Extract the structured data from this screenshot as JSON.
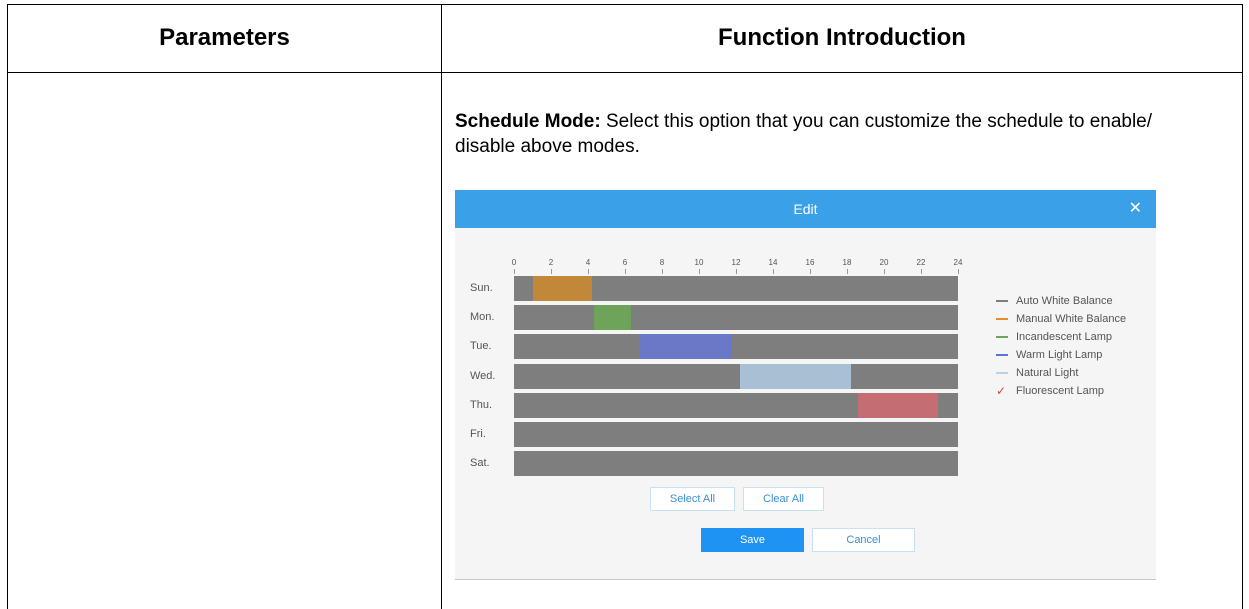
{
  "table": {
    "headers": [
      "Parameters",
      "Function Introduction"
    ]
  },
  "intro": {
    "label": "Schedule Mode:",
    "text": " Select this option that you can customize the schedule to enable/ disable above modes."
  },
  "dialog": {
    "title": "Edit",
    "close_icon": "close-icon",
    "tick_labels": [
      "0",
      "2",
      "4",
      "6",
      "8",
      "10",
      "12",
      "14",
      "16",
      "18",
      "20",
      "22",
      "24"
    ],
    "days": [
      "Sun.",
      "Mon.",
      "Tue.",
      "Wed.",
      "Thu.",
      "Fri.",
      "Sat."
    ],
    "schedule": [
      [
        {
          "start": 1,
          "end": 4.2,
          "color": "#c08838"
        }
      ],
      [
        {
          "start": 4.3,
          "end": 6.3,
          "color": "#6ea35a"
        }
      ],
      [
        {
          "start": 6.8,
          "end": 11.8,
          "color": "#6979c8"
        }
      ],
      [
        {
          "start": 12.2,
          "end": 18.2,
          "color": "#a9bfd3"
        }
      ],
      [
        {
          "start": 18.6,
          "end": 22.9,
          "color": "#c46e74"
        }
      ],
      [],
      []
    ],
    "legend": [
      {
        "label": "Auto White Balance",
        "color": "#7e7e7e",
        "selected": false
      },
      {
        "label": "Manual White Balance",
        "color": "#e58d2b",
        "selected": false
      },
      {
        "label": "Incandescent Lamp",
        "color": "#6ea35a",
        "selected": false
      },
      {
        "label": "Warm Light Lamp",
        "color": "#5b73d8",
        "selected": false
      },
      {
        "label": "Natural Light",
        "color": "#b8d0e8",
        "selected": false
      },
      {
        "label": "Fluorescent Lamp",
        "color": "#e04040",
        "selected": true
      }
    ],
    "buttons": {
      "select_all": "Select All",
      "clear_all": "Clear All",
      "save": "Save",
      "cancel": "Cancel"
    }
  }
}
